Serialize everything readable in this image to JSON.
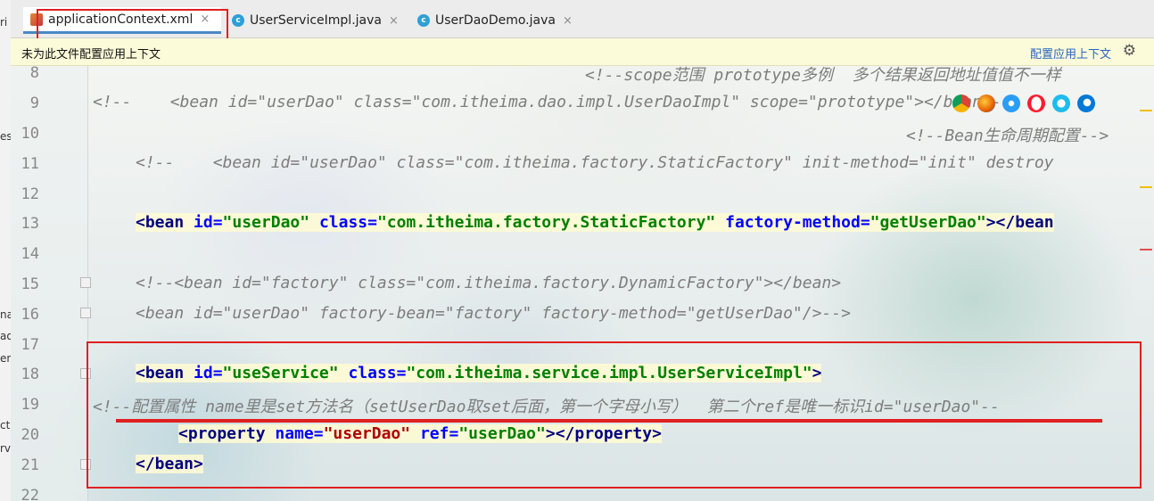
{
  "left_strip": {
    "fragments": [
      "ri",
      "es",
      "na",
      "ao",
      "en",
      "ct",
      "rv"
    ]
  },
  "tabs": [
    {
      "label": "applicationContext.xml",
      "icon": "xml-file-icon",
      "active": true
    },
    {
      "label": "UserServiceImpl.java",
      "icon": "class-icon",
      "active": false
    },
    {
      "label": "UserDaoDemo.java",
      "icon": "class-icon",
      "active": false
    }
  ],
  "tab_close_glyph": "×",
  "class_icon_letter": "c",
  "notice": {
    "message": "未为此文件配置应用上下文",
    "action": "配置应用上下文",
    "gear_glyph": "⚙"
  },
  "line_numbers": [
    "8",
    "9",
    "10",
    "11",
    "12",
    "13",
    "14",
    "15",
    "16",
    "17",
    "18",
    "19",
    "20",
    "21",
    "22"
  ],
  "code": {
    "l8": "<!--scope范围 prototype多例  多个结果返回地址值值不一样",
    "l9": "<!--    <bean id=\"userDao\" class=\"com.itheima.dao.impl.UserDaoImpl\" scope=\"prototype\"></bean>-->",
    "l10": "<!--Bean生命周期配置-->",
    "l11": "<!--    <bean id=\"userDao\" class=\"com.itheima.factory.StaticFactory\" init-method=\"init\" destroy",
    "l13": {
      "open": "<bean ",
      "a1": "id=",
      "v1": "\"userDao\"",
      "a2": "class=",
      "v2": "\"com.itheima.factory.StaticFactory\"",
      "a3": "factory-method=",
      "v3": "\"getUserDao\"",
      "close": "></bean"
    },
    "l15": "<!--<bean id=\"factory\" class=\"com.itheima.factory.DynamicFactory\"></bean>",
    "l16": "<bean id=\"userDao\" factory-bean=\"factory\" factory-method=\"getUserDao\"/>-->",
    "l18": {
      "open": "<bean ",
      "a1": "id=",
      "v1": "\"useService\"",
      "a2": "class=",
      "v2": "\"com.itheima.service.impl.UserServiceImpl\"",
      "close": ">"
    },
    "l19": "<!--配置属性 name里是set方法名（setUserDao取set后面，第一个字母小写）  第二个ref是唯一标识id=\"userDao\"--",
    "l20": {
      "open": "<property ",
      "a1": "name=",
      "v1": "\"userDao\"",
      "a2": "ref=",
      "v2": "\"userDao\"",
      "close": "></property>"
    },
    "l21": "</bean>"
  },
  "browser_icons": [
    "chrome-icon",
    "firefox-icon",
    "safari-icon",
    "opera-icon",
    "ie-icon",
    "edge-icon"
  ],
  "colors": {
    "tag": "#000080",
    "attr": "#0000ff",
    "value": "#008000",
    "comment": "#7d7d7d",
    "annotation_red": "#e02020",
    "notice_bg": "#fbfbd9",
    "link": "#2a64c4"
  }
}
